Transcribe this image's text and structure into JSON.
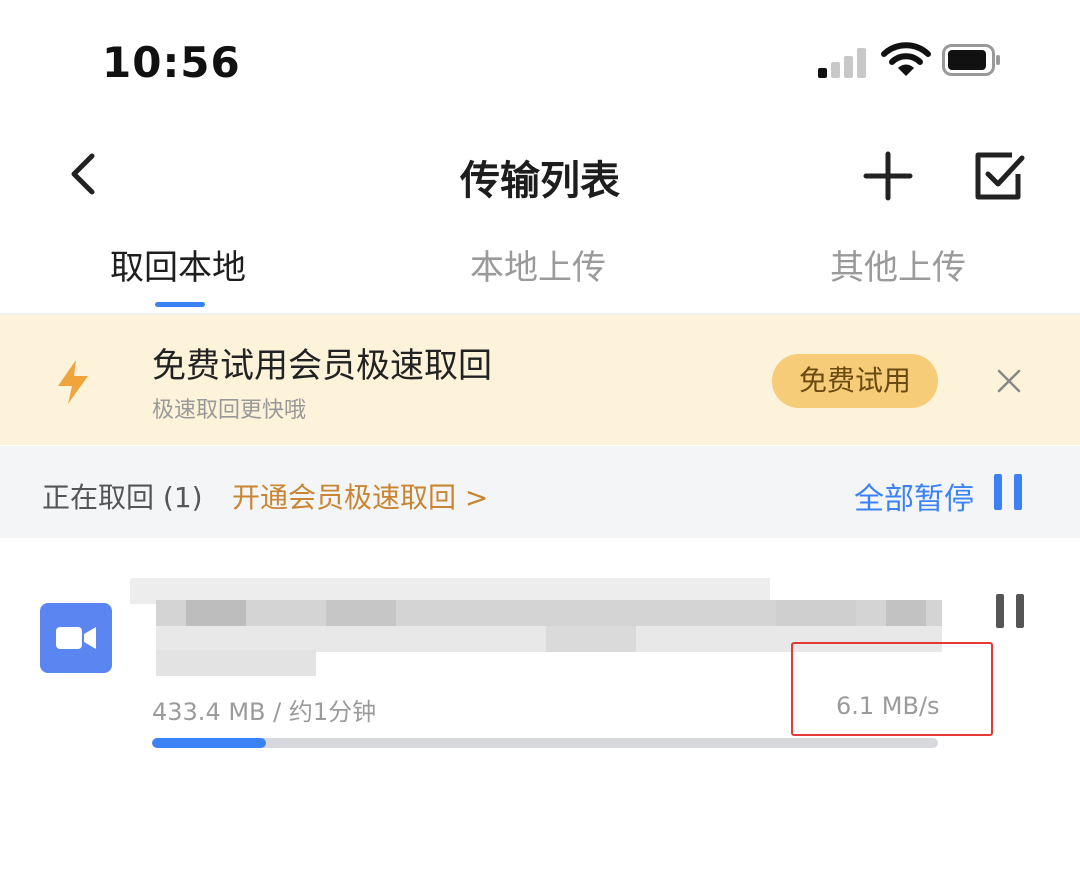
{
  "status_bar": {
    "time": "10:56",
    "signal_icon": "cellular-signal-icon",
    "wifi_icon": "wifi-icon",
    "battery_icon": "battery-icon"
  },
  "nav": {
    "title": "传输列表",
    "back_icon": "chevron-left-icon",
    "add_icon": "plus-icon",
    "select_icon": "checkbox-icon"
  },
  "tabs": [
    {
      "label": "取回本地",
      "active": true
    },
    {
      "label": "本地上传",
      "active": false
    },
    {
      "label": "其他上传",
      "active": false
    }
  ],
  "promo": {
    "title": "免费试用会员极速取回",
    "subtitle": "极速取回更快哦",
    "button_label": "免费试用",
    "icon": "lightning-bolt-icon",
    "close_icon": "close-icon"
  },
  "section": {
    "status_label": "正在取回 (1)",
    "upgrade_link": "开通会员极速取回 >",
    "pause_all_label": "全部暂停",
    "pause_icon": "pause-icon"
  },
  "transfer_item": {
    "file_type_icon": "video-camera-icon",
    "meta": "433.4 MB / 约1分钟",
    "speed": "6.1 MB/s",
    "progress": 0.145,
    "pause_icon": "pause-icon"
  },
  "colors": {
    "accent": "#3b82f6",
    "promo_background": "#fdf3da",
    "promo_button": "#f6cc78",
    "upgrade_link": "#c98532",
    "video_icon_bg": "#5b86f1",
    "highlight": "#e53935"
  }
}
